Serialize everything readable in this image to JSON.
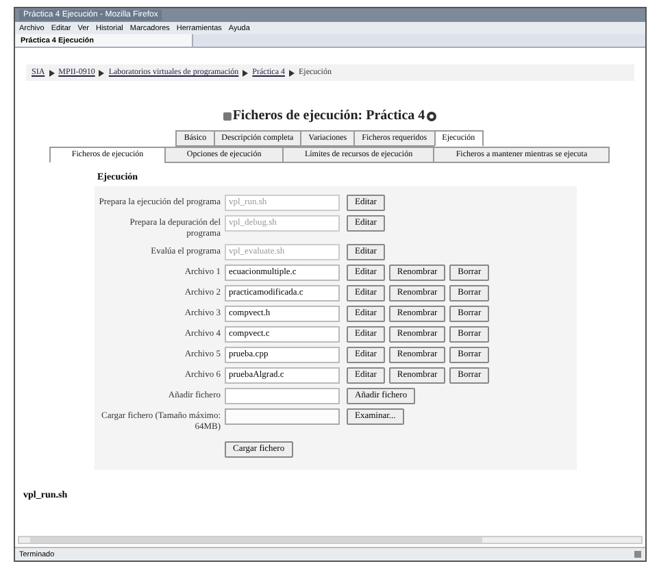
{
  "window": {
    "title": "Práctica 4 Ejecución - Mozilla Firefox"
  },
  "menu": [
    "Archivo",
    "Editar",
    "Ver",
    "Historial",
    "Marcadores",
    "Herramientas",
    "Ayuda"
  ],
  "browser_tab": {
    "label": "Práctica 4 Ejecución"
  },
  "breadcrumb": [
    "SIA",
    "MPII-0910",
    "Laboratorios virtuales de programación",
    "Práctica 4",
    "Ejecución"
  ],
  "heading": "Ficheros de ejecución: Práctica 4",
  "tabs": [
    {
      "label": "Básico",
      "selected": false
    },
    {
      "label": "Descripción completa",
      "selected": false
    },
    {
      "label": "Variaciones",
      "selected": false
    },
    {
      "label": "Ficheros requeridos",
      "selected": false
    },
    {
      "label": "Ejecución",
      "selected": true
    }
  ],
  "subtabs": [
    {
      "label": "Ficheros de ejecución",
      "selected": true
    },
    {
      "label": "Opciones de ejecución",
      "selected": false
    },
    {
      "label": "Límites de recursos de ejecución",
      "selected": false
    },
    {
      "label": "Ficheros a mantener mientras se ejecuta",
      "selected": false
    }
  ],
  "section_title": "Ejecución",
  "rows": [
    {
      "kind": "script",
      "label": "Prepara la ejecución del programa",
      "value": "vpl_run.sh",
      "buttons": [
        "Editar"
      ]
    },
    {
      "kind": "script",
      "label": "Prepara la depuración del programa",
      "value": "vpl_debug.sh",
      "buttons": [
        "Editar"
      ]
    },
    {
      "kind": "script",
      "label": "Evalúa el programa",
      "value": "vpl_evaluate.sh",
      "buttons": [
        "Editar"
      ]
    },
    {
      "kind": "file",
      "label": "Archivo 1",
      "value": "ecuacionmultiple.c",
      "buttons": [
        "Editar",
        "Renombrar",
        "Borrar"
      ]
    },
    {
      "kind": "file",
      "label": "Archivo 2",
      "value": "practicamodificada.c",
      "buttons": [
        "Editar",
        "Renombrar",
        "Borrar"
      ]
    },
    {
      "kind": "file",
      "label": "Archivo 3",
      "value": "compvect.h",
      "buttons": [
        "Editar",
        "Renombrar",
        "Borrar"
      ]
    },
    {
      "kind": "file",
      "label": "Archivo 4",
      "value": "compvect.c",
      "buttons": [
        "Editar",
        "Renombrar",
        "Borrar"
      ]
    },
    {
      "kind": "file",
      "label": "Archivo 5",
      "value": "prueba.cpp",
      "buttons": [
        "Editar",
        "Renombrar",
        "Borrar"
      ]
    },
    {
      "kind": "file",
      "label": "Archivo 6",
      "value": "pruebaAlgrad.c",
      "buttons": [
        "Editar",
        "Renombrar",
        "Borrar"
      ]
    },
    {
      "kind": "add",
      "label": "Añadir fichero",
      "buttons": [
        "Añadir fichero"
      ]
    },
    {
      "kind": "upload",
      "label": "Cargar fichero (Tamaño máximo: 64MB)",
      "buttons": [
        "Examinar..."
      ]
    }
  ],
  "submit": "Cargar fichero",
  "footer_heading": "vpl_run.sh",
  "status_bar": "Terminado"
}
